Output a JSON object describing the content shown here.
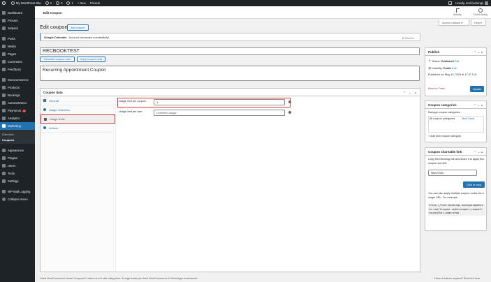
{
  "admin_bar": {
    "site_name": "My WordPress Site",
    "updates": "2",
    "comments": "0",
    "new_count": "1",
    "new_label": "+ New",
    "presets": "Presets",
    "howdy": "Howdy, test-bookings"
  },
  "sidebar": {
    "items": [
      {
        "label": "Dashboard",
        "icon": "dashboard-icon"
      },
      {
        "label": "Presets",
        "icon": "presets-icon"
      },
      {
        "label": "Jetpack",
        "icon": "jetpack-icon"
      },
      {
        "label": "Posts",
        "icon": "posts-icon"
      },
      {
        "label": "Media",
        "icon": "media-icon"
      },
      {
        "label": "Pages",
        "icon": "pages-icon"
      },
      {
        "label": "Comments",
        "icon": "comments-icon"
      },
      {
        "label": "Feedback",
        "icon": "feedback-icon"
      },
      {
        "label": "WooCommerce",
        "icon": "woocommerce-icon"
      },
      {
        "label": "Products",
        "icon": "products-icon"
      },
      {
        "label": "Bookings",
        "icon": "bookings-icon"
      },
      {
        "label": "AutomateWoo",
        "icon": "automatewoo-icon"
      },
      {
        "label": "Payments",
        "icon": "payments-icon",
        "badge": "1"
      },
      {
        "label": "Analytics",
        "icon": "analytics-icon"
      },
      {
        "label": "Marketing",
        "icon": "marketing-icon",
        "active": true
      },
      {
        "label": "Appearance",
        "icon": "appearance-icon"
      },
      {
        "label": "Plugins",
        "icon": "plugins-icon"
      },
      {
        "label": "Users",
        "icon": "users-icon"
      },
      {
        "label": "Tools",
        "icon": "tools-icon"
      },
      {
        "label": "Settings",
        "icon": "settings-icon"
      },
      {
        "label": "WP Mail Logging",
        "icon": "mail-icon"
      },
      {
        "label": "Collapse menu",
        "icon": "collapse-icon"
      }
    ],
    "submenu": [
      "Overview",
      "Coupons"
    ]
  },
  "header": {
    "page_label": "Edit Coupon",
    "activity": "Activity",
    "finish_setup": "Finish setup",
    "screen_options": "Screen Options ▾",
    "help": "Help ▾"
  },
  "page": {
    "title": "Edit coupon",
    "add_coupon": "Add coupon",
    "notice_bold": "Google Calendar:",
    "notice_text": "Account connected successfully!",
    "dismiss": "Dismiss",
    "coupon_code": "RECBOOKTEST",
    "generate_code": "Generate coupon code",
    "copy_code": "Copy coupon code",
    "description": "Recurring Appointment Coupon"
  },
  "coupon_data": {
    "title": "Coupon data",
    "tabs": [
      "General",
      "Usage restriction",
      "Usage limits",
      "Actions"
    ],
    "limit_per_coupon_label": "Usage limit per coupon",
    "limit_per_coupon_value": "1",
    "limit_per_user_label": "Usage limit per user",
    "limit_per_user_placeholder": "Unlimited usage"
  },
  "publish": {
    "title": "Publish",
    "status_label": "Status:",
    "status_value": "Published",
    "visibility_label": "Visibility:",
    "visibility_value": "Public",
    "published_on": "Published on: May 19, 2024 at 17:47",
    "edit": "Edit",
    "trash": "Move to Trash",
    "update": "Update"
  },
  "categories": {
    "title": "Coupon categories",
    "manage": "Manage coupon categories",
    "tab_all": "All coupon categories",
    "tab_used": "Most Used",
    "add_new": "+ Add new coupon category"
  },
  "shareable": {
    "title": "Coupon shareable link",
    "intro": "Copy the following link and share it to apply this coupon via URL.",
    "url_value": "https://test-",
    "copy_btn": "Click to copy",
    "multi_text": "You can also apply multiple coupon codes via a single URL. For example:",
    "example": "https://test-bookings.mystagingwebsite.com/?coupon-code=coupon1,coupon2,coupon3&sc-page=shop"
  },
  "footer": {
    "left": "Liked WooCommerce Smart Coupons? Leave us a 5 star rating here. A huge thank you from WooCommerce & StoreApps in advance!",
    "right": "Have a feature request? Submit it here."
  },
  "colors": {
    "accent": "#2271b1",
    "alert": "#d63638",
    "admin_bg": "#1d2327"
  }
}
